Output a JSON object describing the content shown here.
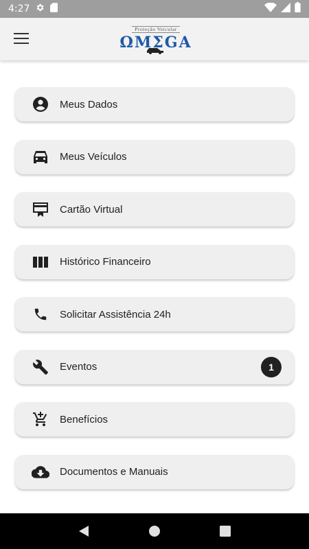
{
  "status_bar": {
    "time": "4:27",
    "icons": [
      "gear-icon",
      "sd-card-icon",
      "wifi-icon",
      "signal-icon",
      "battery-icon"
    ]
  },
  "header": {
    "logo_subtitle": "Proteção Veicular",
    "logo_title": "ΩMΣGA",
    "menu_icon": "hamburger-icon"
  },
  "menu": {
    "items": [
      {
        "label": "Meus Dados",
        "icon": "account-circle-icon"
      },
      {
        "label": "Meus Veículos",
        "icon": "car-icon"
      },
      {
        "label": "Cartão Virtual",
        "icon": "card-icon"
      },
      {
        "label": "Histórico Financeiro",
        "icon": "columns-icon"
      },
      {
        "label": "Solicitar Assistência 24h",
        "icon": "phone-icon"
      },
      {
        "label": "Eventos",
        "icon": "wrench-icon",
        "badge": "1"
      },
      {
        "label": "Benefícios",
        "icon": "add-cart-icon"
      },
      {
        "label": "Documentos e Manuais",
        "icon": "cloud-download-icon"
      }
    ]
  },
  "nav_bar": {
    "buttons": [
      "back-icon",
      "home-icon",
      "recents-icon"
    ]
  },
  "colors": {
    "status_bar": "#9e9e9e",
    "app_bar": "#f2f2f2",
    "menu_item_bg": "#efefef",
    "logo_blue": "#1e58a8",
    "badge": "#212121"
  }
}
